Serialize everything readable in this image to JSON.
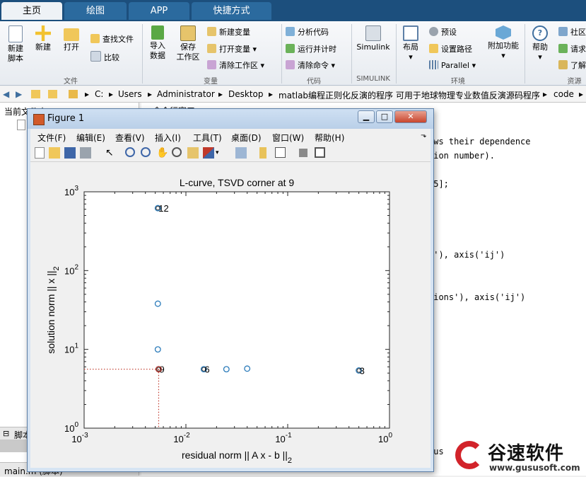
{
  "tabs": [
    {
      "label": "主页",
      "active": true
    },
    {
      "label": "绘图",
      "active": false
    },
    {
      "label": "APP",
      "active": false
    },
    {
      "label": "快捷方式",
      "active": false
    }
  ],
  "ribbon": {
    "new_script": "新建\n脚本",
    "new": "新建",
    "open": "打开",
    "find_files": "查找文件",
    "compare": "比较",
    "group_file": "文件",
    "import_data": "导入\n数据",
    "save_workspace": "保存\n工作区",
    "new_variable": "新建变量",
    "open_variable": "打开变量",
    "clear_workspace": "清除工作区",
    "group_variable": "变量",
    "analyze_code": "分析代码",
    "run_time": "运行并计时",
    "clear_commands": "清除命令",
    "group_code": "代码",
    "simulink": "Simulink",
    "group_simulink": "SIMULINK",
    "layout": "布局",
    "preferences": "预设",
    "set_path": "设置路径",
    "parallel": "Parallel",
    "group_env": "环境",
    "addons": "附加功能",
    "help": "帮助",
    "community": "社区",
    "request": "请求",
    "learn": "了解",
    "group_resources": "资源"
  },
  "address": {
    "segments": [
      "C:",
      "Users",
      "Administrator",
      "Desktop",
      "matlab编程正则化反演的程序 可用于地球物理专业数值反演源码程序",
      "code"
    ]
  },
  "left_pane": {
    "current_folder": "当前文件夹",
    "details": "脚本",
    "file": "main.m (脚本)"
  },
  "cmd": {
    "header": "命令行窗口",
    "lines": [
      {
        "t": "ows their dependence",
        "y": 199
      },
      {
        "t": "tion number).",
        "y": 219
      },
      {
        "t": "-5];",
        "y": 259
      },
      {
        "t": "s'), axis('ij')",
        "y": 359
      },
      {
        "t": ")",
        "y": 399
      },
      {
        "t": "tions'), axis('ij')",
        "y": 419
      },
      {
        "t": ")",
        "y": 439
      },
      {
        "t": "r",
        "y": 579
      },
      {
        "t": "hus",
        "y": 637
      }
    ]
  },
  "figure": {
    "title": "Figure 1",
    "menu": [
      "文件(F)",
      "编辑(E)",
      "查看(V)",
      "插入(I)",
      "工具(T)",
      "桌面(D)",
      "窗口(W)",
      "帮助(H)"
    ]
  },
  "chart_data": {
    "type": "scatter",
    "title": "L-curve, TSVD corner at 9",
    "xlabel": "residual norm || A x - b ||",
    "xlabel_sub": "2",
    "ylabel": "solution norm || x ||",
    "ylabel_sub": "2",
    "xscale": "log",
    "yscale": "log",
    "xlim": [
      0.001,
      1
    ],
    "ylim": [
      1,
      1000
    ],
    "xticks": [
      "10",
      "10",
      "10",
      "10"
    ],
    "xtick_exp": [
      "-3",
      "-2",
      "-1",
      "0"
    ],
    "yticks": [
      "10",
      "10",
      "10",
      "10"
    ],
    "ytick_exp": [
      "0",
      "1",
      "2",
      "3"
    ],
    "marker_color": "#2b7bba",
    "corner_color": "#c0392b",
    "points": [
      {
        "x": 0.0053,
        "y": 620,
        "label": "12"
      },
      {
        "x": 0.0053,
        "y": 38,
        "label": ""
      },
      {
        "x": 0.0053,
        "y": 10,
        "label": ""
      },
      {
        "x": 0.0054,
        "y": 5.6,
        "label": "9"
      },
      {
        "x": 0.015,
        "y": 5.6,
        "label": "6"
      },
      {
        "x": 0.025,
        "y": 5.6,
        "label": ""
      },
      {
        "x": 0.04,
        "y": 5.7,
        "label": ""
      },
      {
        "x": 0.5,
        "y": 5.4,
        "label": "3"
      }
    ],
    "corner": {
      "x": 0.0054,
      "y": 5.6
    }
  },
  "watermark": {
    "brand": "谷速软件",
    "url": "www.gususoft.com"
  }
}
